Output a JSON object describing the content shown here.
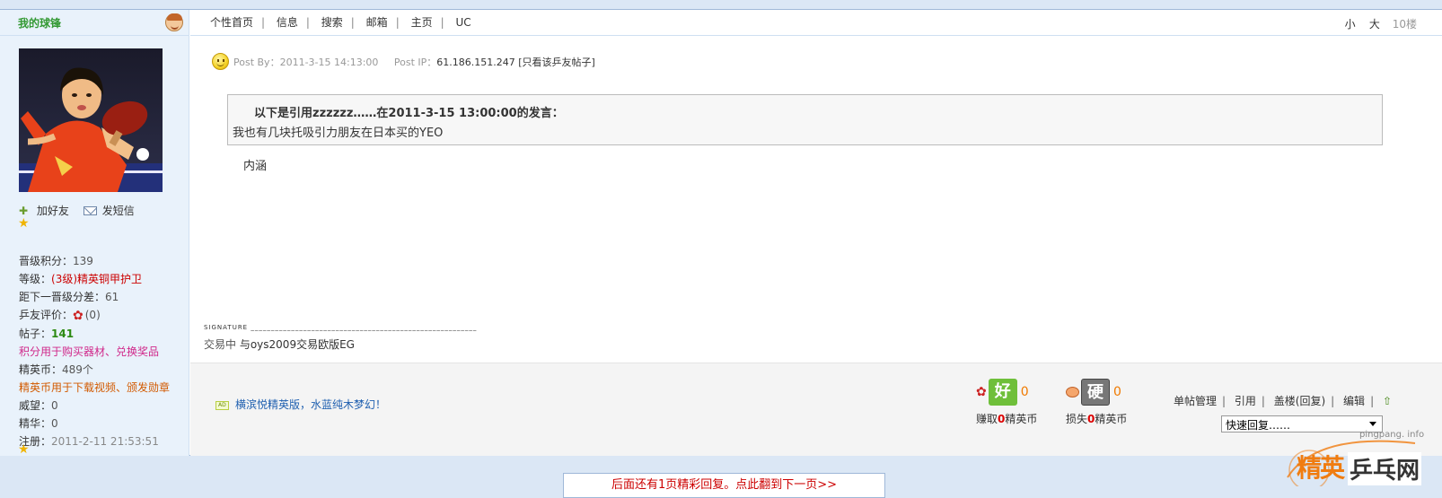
{
  "left": {
    "username": "我的球锋",
    "actions": {
      "add_friend": "加好友",
      "send_msg": "发短信"
    },
    "stats": [
      {
        "label": "晋级积分：",
        "value": "139",
        "cls": "v"
      },
      {
        "label": "等级：",
        "value": "(3级)精英铜甲护卫",
        "cls": "red"
      },
      {
        "label": "距下一晋级分差：",
        "value": "61",
        "cls": "v"
      },
      {
        "label": "乒友评价：",
        "value": "(0)",
        "cls": "v"
      },
      {
        "label": "帖子：",
        "value": "141",
        "cls": "green"
      },
      {
        "label": "",
        "value": "积分用于购买器材、兑换奖品",
        "cls": "pink"
      },
      {
        "label": "精英币：",
        "value": "489个",
        "cls": "v"
      },
      {
        "label": "",
        "value": "精英币用于下载视频、颁发勋章",
        "cls": "orange"
      },
      {
        "label": "威望：",
        "value": "0",
        "cls": "v"
      },
      {
        "label": "精华：",
        "value": "0",
        "cls": "v"
      },
      {
        "label": "注册：",
        "value": "2011-2-11 21:53:51",
        "cls": "grey"
      }
    ]
  },
  "topnav": {
    "items": [
      "个性首页",
      "信息",
      "搜索",
      "邮箱",
      "主页",
      "UC"
    ],
    "font_small": "小",
    "font_large": "大",
    "floor": "10楼"
  },
  "post": {
    "posted_by_label": "Post By：",
    "posted_at": "2011-3-15 14:13:00",
    "ip_label": "Post IP：",
    "ip": "61.186.151.247",
    "only_this_user": "[只看该乒友帖子]",
    "quote_header": "以下是引用zzzzzz……在2011-3-15 13:00:00的发言：",
    "quote_body": "我也有几块托吸引力朋友在日本买的YEO",
    "content": "内涵",
    "signature_line": "SIGNATURE ________________________________________________________",
    "signature_prefix": "交易中",
    "signature_link": "与oys2009交易欧版EG"
  },
  "footer": {
    "ad_tag": "AD",
    "ad_text": "横滨悦精英版，水蓝纯木梦幻！",
    "good": {
      "icon_text": "好",
      "count": "0",
      "label_pre": "赚取",
      "label_num": "0",
      "label_post": "精英币"
    },
    "bad": {
      "icon_text": "硬",
      "count": "0",
      "label_pre": "损失",
      "label_num": "0",
      "label_post": "精英币"
    },
    "ops": [
      "单帖管理",
      "引用",
      "盖楼(回复)",
      "编辑"
    ],
    "quick_reply": "快速回复……"
  },
  "watermark": {
    "site": "pingpang. info",
    "brand_a": "精英",
    "brand_b": "乒乓网"
  },
  "next_page": "后面还有1页精彩回复。点此翻到下一页>>",
  "colors": {
    "accent_red": "#cc0000",
    "brand_green": "#339933",
    "page_bg": "#dbe7f5"
  }
}
